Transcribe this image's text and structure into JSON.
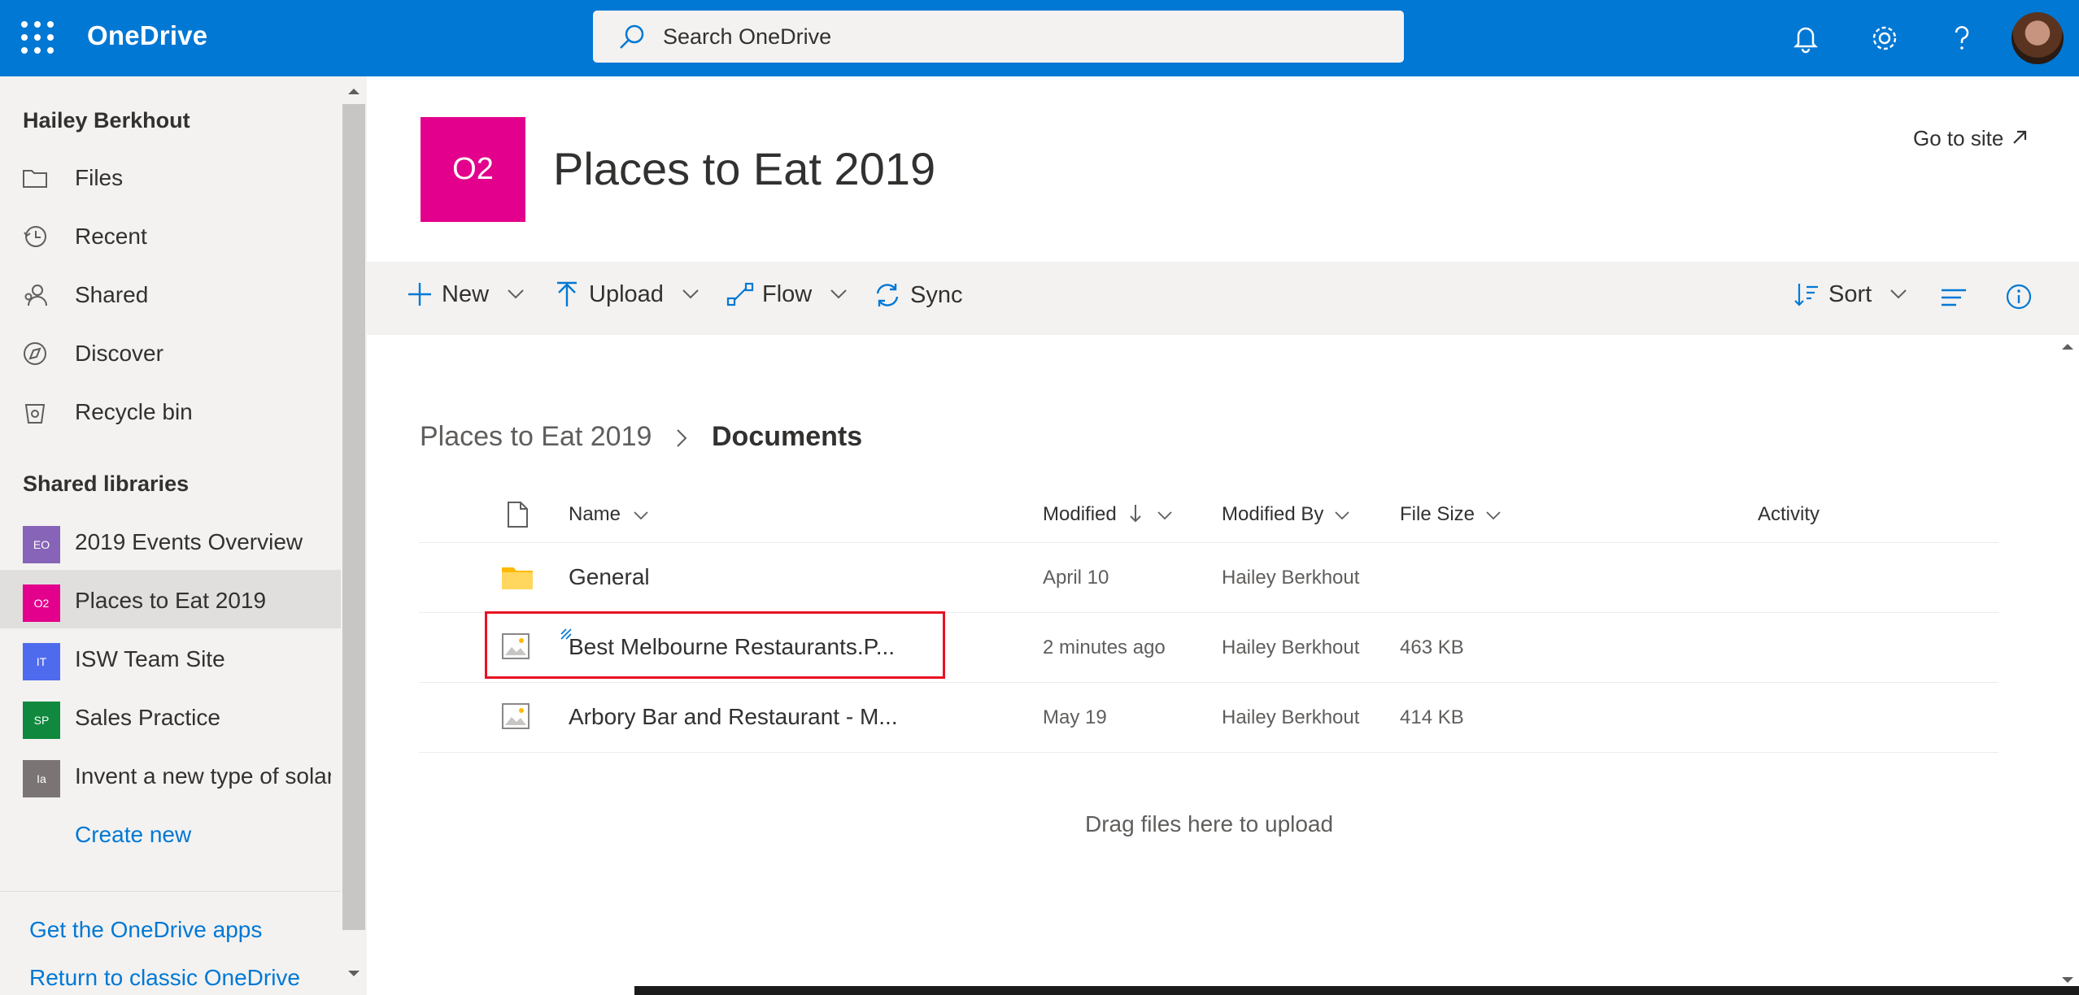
{
  "app": {
    "brand": "OneDrive"
  },
  "search": {
    "placeholder": "Search OneDrive"
  },
  "sidebar": {
    "user": "Hailey Berkhout",
    "nav": [
      {
        "label": "Files",
        "icon": "folder-icon"
      },
      {
        "label": "Recent",
        "icon": "history-icon"
      },
      {
        "label": "Shared",
        "icon": "people-icon"
      },
      {
        "label": "Discover",
        "icon": "compass-icon"
      },
      {
        "label": "Recycle bin",
        "icon": "recycle-bin-icon"
      }
    ],
    "libraries_heading": "Shared libraries",
    "libraries": [
      {
        "label": "2019 Events Overview",
        "initials": "EO",
        "color": "#8764b8"
      },
      {
        "label": "Places to Eat 2019",
        "initials": "O2",
        "color": "#e3008c",
        "selected": true
      },
      {
        "label": "ISW Team Site",
        "initials": "IT",
        "color": "#4f6bed"
      },
      {
        "label": "Sales Practice",
        "initials": "SP",
        "color": "#10893e"
      },
      {
        "label": "Invent a new type of solar",
        "initials": "Ia",
        "color": "#7a7574"
      }
    ],
    "create_new": "Create new",
    "get_apps": "Get the OneDrive apps",
    "return_classic": "Return to classic OneDrive"
  },
  "site": {
    "initials": "O2",
    "title": "Places to Eat 2019",
    "goto": "Go to site"
  },
  "commands": {
    "new": "New",
    "upload": "Upload",
    "flow": "Flow",
    "sync": "Sync",
    "sort": "Sort"
  },
  "breadcrumb": {
    "parent": "Places to Eat 2019",
    "current": "Documents"
  },
  "columns": {
    "name": "Name",
    "modified": "Modified",
    "modified_by": "Modified By",
    "file_size": "File Size",
    "activity": "Activity"
  },
  "files": [
    {
      "name": "General",
      "modified": "April 10",
      "modified_by": "Hailey Berkhout",
      "size": "",
      "type": "folder"
    },
    {
      "name": "Best Melbourne Restaurants.P...",
      "modified": "2 minutes ago",
      "modified_by": "Hailey Berkhout",
      "size": "463 KB",
      "type": "image"
    },
    {
      "name": "Arbory Bar and Restaurant - M...",
      "modified": "May 19",
      "modified_by": "Hailey Berkhout",
      "size": "414 KB",
      "type": "image"
    }
  ],
  "drop_hint": "Drag files here to upload",
  "colors": {
    "accent": "#0078d4",
    "site_tile": "#e3008c",
    "highlight": "#e81123"
  }
}
